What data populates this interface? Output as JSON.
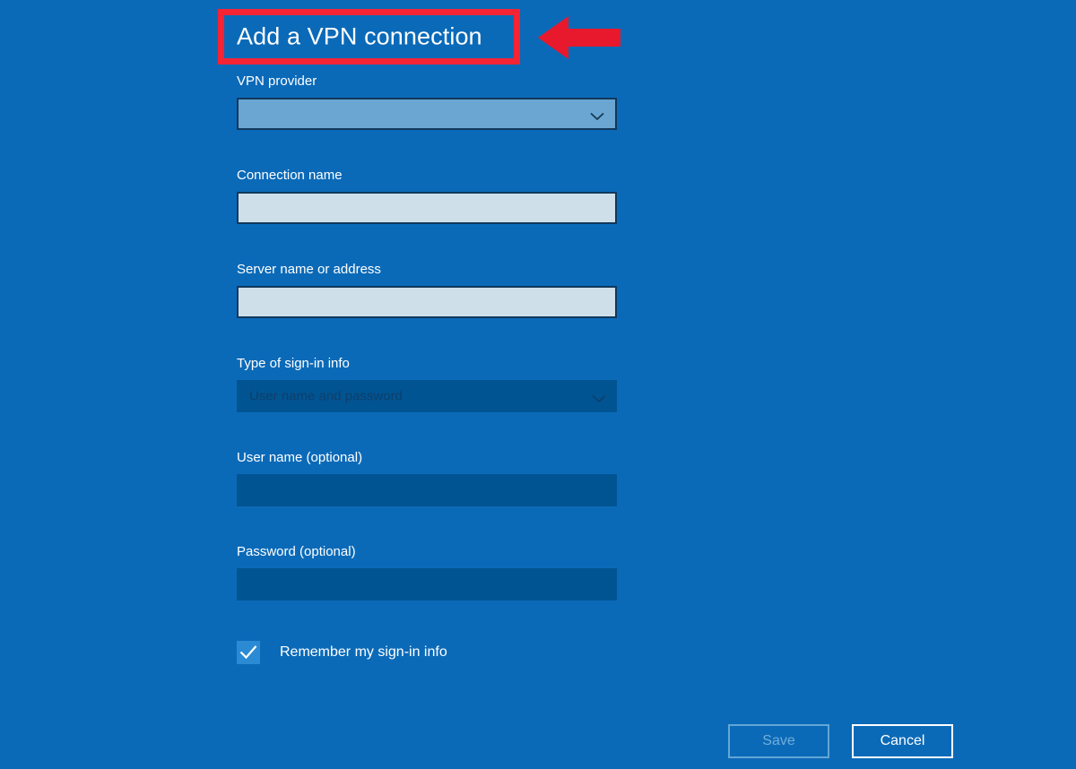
{
  "page": {
    "title": "Add a VPN connection",
    "background_color": "#0b6ab8"
  },
  "annotation": {
    "highlight_color": "#f42434",
    "arrow_color": "#e8192c",
    "arrow_direction": "left",
    "target": "Add a VPN connection"
  },
  "form": {
    "fields": [
      {
        "label": "VPN provider",
        "type": "dropdown",
        "value": "",
        "enabled": true,
        "fill_color": "#6ba5d2"
      },
      {
        "label": "Connection name",
        "type": "text",
        "value": "",
        "enabled": true,
        "fill_color": "#cfdfe9"
      },
      {
        "label": "Server name or address",
        "type": "text",
        "value": "",
        "enabled": true,
        "fill_color": "#cfdfe9"
      },
      {
        "label": "Type of sign-in info",
        "type": "dropdown",
        "value": "User name and password",
        "enabled": false,
        "fill_color": "#015492"
      },
      {
        "label": "User name (optional)",
        "type": "text",
        "value": "",
        "enabled": false,
        "fill_color": "#015492"
      },
      {
        "label": "Password (optional)",
        "type": "text",
        "value": "",
        "enabled": false,
        "fill_color": "#015492"
      }
    ],
    "checkbox": {
      "label": "Remember my sign-in info",
      "checked": true,
      "fill_color": "#2a8ad4"
    }
  },
  "buttons": {
    "save": {
      "label": "Save",
      "enabled": false
    },
    "cancel": {
      "label": "Cancel",
      "enabled": true
    }
  }
}
